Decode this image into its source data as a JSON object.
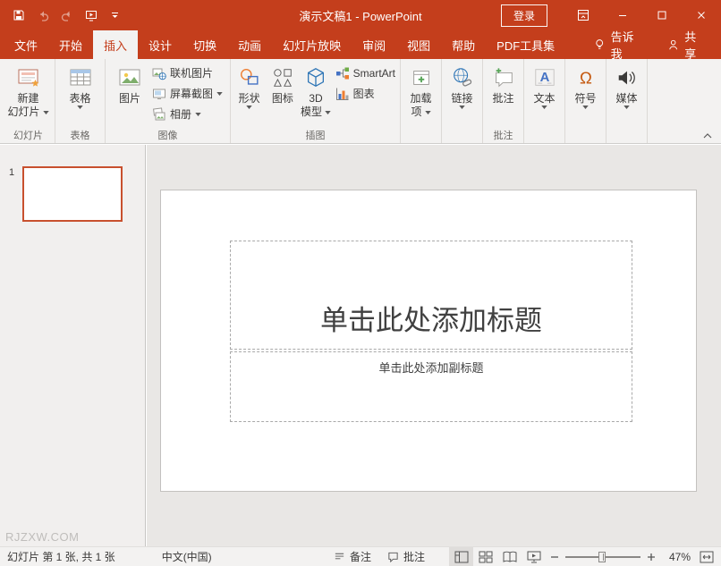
{
  "colors": {
    "accent": "#C43E1C",
    "ribbon_bg": "#F3F2F1",
    "canvas_bg": "#E9E7E5",
    "selected_slide_border": "#C8502E"
  },
  "titlebar": {
    "title": "演示文稿1 - PowerPoint",
    "login": "登录"
  },
  "tabs": {
    "items": [
      "文件",
      "开始",
      "插入",
      "设计",
      "切换",
      "动画",
      "幻灯片放映",
      "审阅",
      "视图",
      "帮助",
      "PDF工具集"
    ],
    "active": "插入",
    "tell_me": "告诉我",
    "share": "共享"
  },
  "ribbon": {
    "new_slide_1": "新建",
    "new_slide_2": "幻灯片",
    "slides_label": "幻灯片",
    "table": "表格",
    "tables_label": "表格",
    "picture": "图片",
    "online_pictures": "联机图片",
    "screenshot": "屏幕截图",
    "photo_album": "相册",
    "images_label": "图像",
    "shapes": "形状",
    "icons": "图标",
    "model3d_1": "3D",
    "model3d_2": "模型",
    "smartart": "SmartArt",
    "chart": "图表",
    "illustrations_label": "插图",
    "addins_1": "加载",
    "addins_2": "项",
    "links": "链接",
    "comment": "批注",
    "comments_label": "批注",
    "text": "文本",
    "symbols": "符号",
    "media": "媒体"
  },
  "slides_panel": {
    "slide1_number": "1"
  },
  "slide": {
    "title_placeholder": "单击此处添加标题",
    "subtitle_placeholder": "单击此处添加副标题"
  },
  "watermark": "RJZXW.COM",
  "statusbar": {
    "slide_info": "幻灯片 第 1 张, 共 1 张",
    "language": "中文(中国)",
    "notes": "备注",
    "comments": "批注",
    "zoom": "47%"
  }
}
